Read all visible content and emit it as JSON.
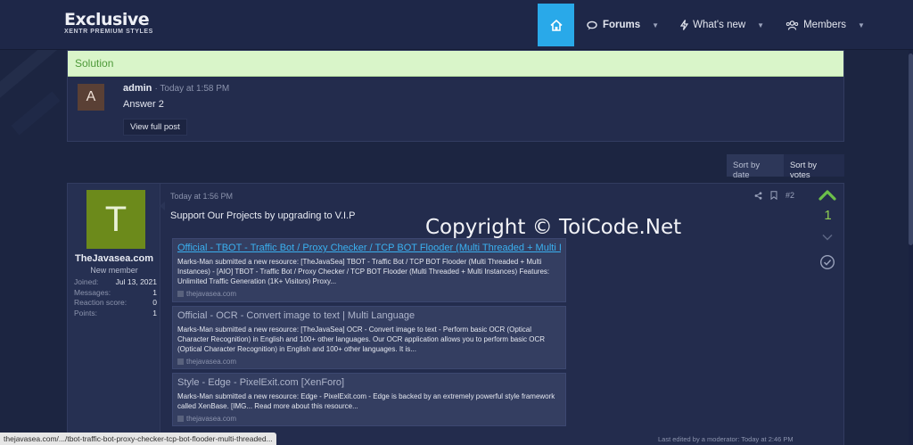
{
  "header": {
    "logo_title": "Exclusive",
    "logo_subtitle": "XENTR PREMIUM STYLES",
    "nav": [
      {
        "label": "Forums",
        "icon": "chat-icon"
      },
      {
        "label": "What's new",
        "icon": "bolt-icon"
      },
      {
        "label": "Members",
        "icon": "users-icon"
      }
    ],
    "home_color": "#29a9e9"
  },
  "solution": {
    "heading": "Solution",
    "avatar_letter": "A",
    "author": "admin",
    "time": "· Today at 1:58 PM",
    "text": "Answer 2",
    "button": "View full post"
  },
  "sort": {
    "by_date": "Sort by date",
    "by_votes": "Sort by votes"
  },
  "post": {
    "user": {
      "avatar_letter": "T",
      "name": "TheJavasea.com",
      "title": "New member",
      "stats": [
        {
          "k": "Joined:",
          "v": "Jul 13, 2021"
        },
        {
          "k": "Messages:",
          "v": "1"
        },
        {
          "k": "Reaction score:",
          "v": "0"
        },
        {
          "k": "Points:",
          "v": "1"
        }
      ]
    },
    "time": "Today at 1:56 PM",
    "number": "#2",
    "title": "Support Our Projects by upgrading to V.I.P",
    "watermark": "Copyright © ToiCode.Net",
    "votes": "1",
    "embeds": [
      {
        "title": "Official - TBOT - Traffic Bot / Proxy Checker / TCP BOT Flooder (Multi Threaded + Multi Ins...",
        "desc": "Marks-Man submitted a new resource: [TheJavaSea] TBOT - Traffic Bot / TCP BOT Flooder (Multi Threaded + Multi Instances) - [AIO] TBOT - Traffic Bot / Proxy Checker / TCP BOT Flooder (Multi Threaded + Multi Instances) Features: Unlimited Traffic Generation (1K+ Visitors) Proxy...",
        "src": "thejavasea.com"
      },
      {
        "title": "Official - OCR - Convert image to text | Multi Language",
        "desc": "Marks-Man submitted a new resource: [TheJavaSea] OCR - Convert image to text - Perform basic OCR (Optical Character Recognition) in English and 100+ other languages. Our OCR application allows you to perform basic OCR (Optical Character Recognition) in English and 100+ other languages. It is...",
        "src": "thejavasea.com"
      },
      {
        "title": "Style - Edge - PixelExit.com [XenForo]",
        "desc": "Marks-Man submitted a new resource: Edge - PixelExit.com - Edge is backed by an extremely powerful style framework called XenBase. [IMG... Read more about this resource...",
        "src": "thejavasea.com"
      }
    ],
    "edited": "Last edited by a moderator: Today at 2:46 PM"
  },
  "statusbar": "thejavasea.com/.../tbot-traffic-bot-proxy-checker-tcp-bot-flooder-multi-threaded..."
}
